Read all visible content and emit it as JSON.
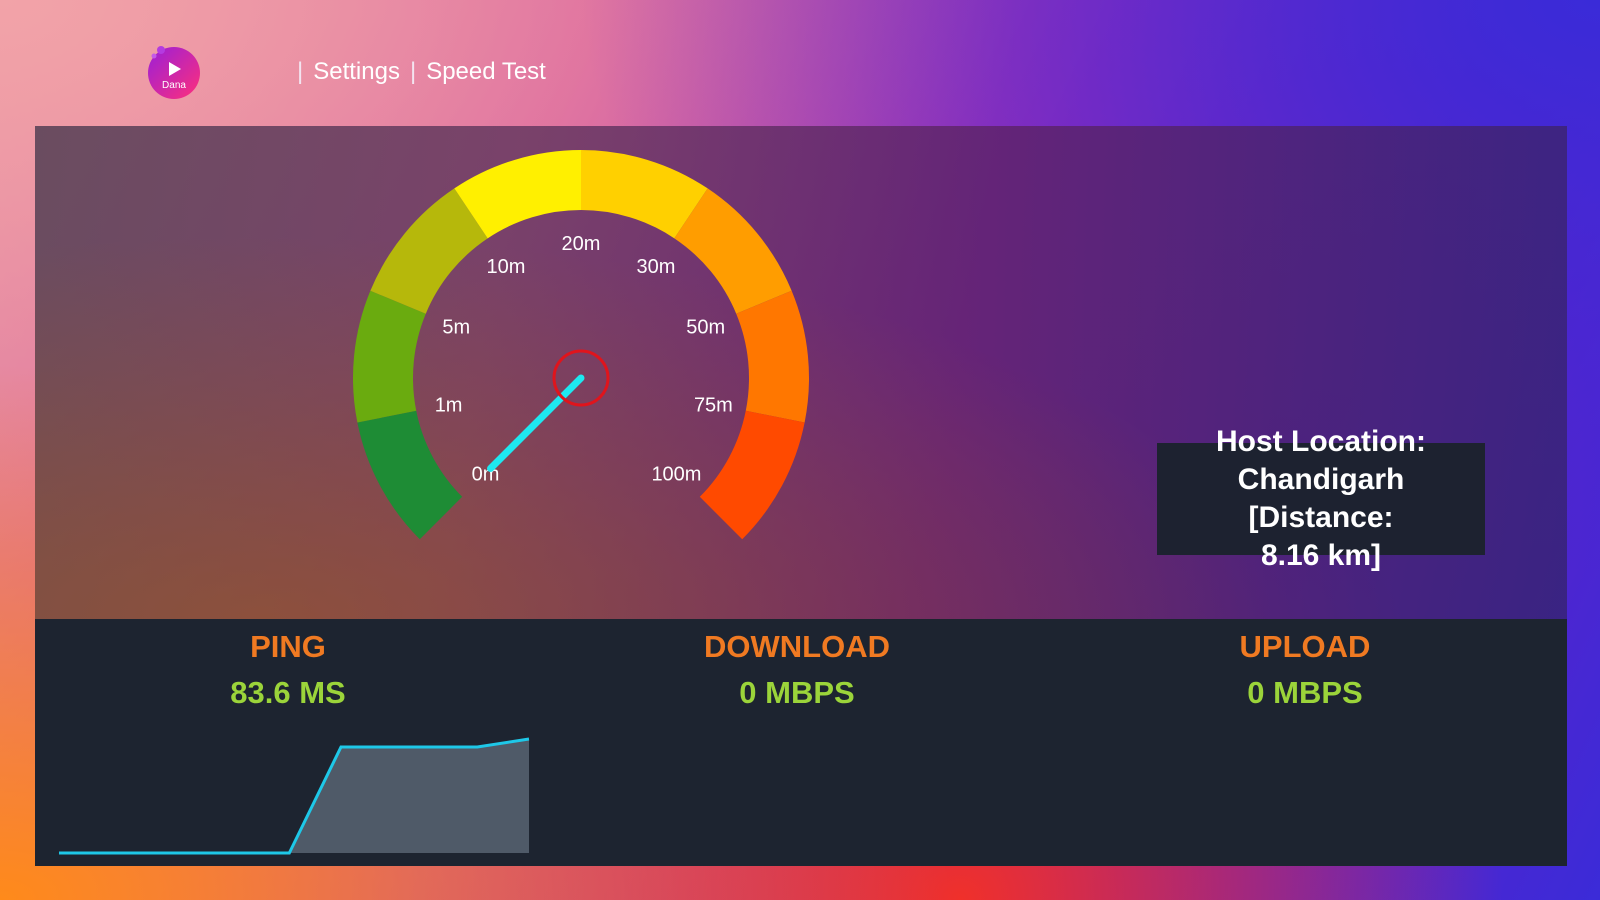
{
  "app": {
    "logo_text": "Dana"
  },
  "breadcrumb": {
    "separator": "|",
    "items": [
      {
        "label": "Settings"
      },
      {
        "label": "Speed Test"
      }
    ]
  },
  "gauge": {
    "tick_labels": [
      "0m",
      "1m",
      "5m",
      "10m",
      "20m",
      "30m",
      "50m",
      "75m",
      "100m"
    ],
    "needle_value_label": "0m",
    "segment_colors": [
      "#1e8c35",
      "#6aab0f",
      "#b6b80b",
      "#fff000",
      "#ffd000",
      "#ff9d00",
      "#ff7700",
      "#ff4a00"
    ],
    "needle_color": "#1ee8f0",
    "hub_color": "#e0141c"
  },
  "host": {
    "text_line1": "Host Location:",
    "text_line2": "Chandigarh [Distance:",
    "text_line3": "8.16 km]"
  },
  "stats": {
    "ping": {
      "label": "PING",
      "value": "83.6 MS"
    },
    "download": {
      "label": "DOWNLOAD",
      "value": "0 MBPS"
    },
    "upload": {
      "label": "UPLOAD",
      "value": "0 MBPS"
    }
  },
  "colors": {
    "accent_label": "#f07a22",
    "accent_value": "#9bd43a",
    "graph_line": "#1ec8e8",
    "graph_fill": "#4f5a68"
  },
  "ping_graph": {
    "points": [
      {
        "x": 0,
        "y": 0
      },
      {
        "x": 0.49,
        "y": 0
      },
      {
        "x": 0.6,
        "y": 0.93
      },
      {
        "x": 0.89,
        "y": 0.93
      },
      {
        "x": 1,
        "y": 1
      }
    ]
  }
}
